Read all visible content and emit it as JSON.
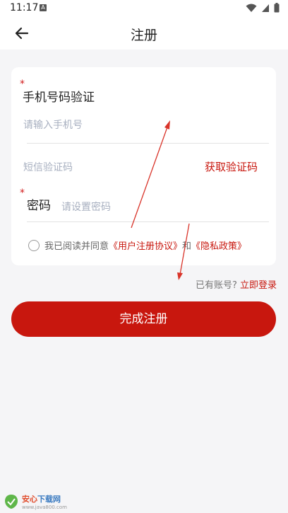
{
  "status": {
    "time": "11:17",
    "notification_badge": "A"
  },
  "appbar": {
    "title": "注册"
  },
  "form": {
    "phone_section_label": "手机号码验证",
    "required_mark": "*",
    "phone_placeholder": "请输入手机号",
    "code_placeholder": "短信验证码",
    "get_code_label": "获取验证码",
    "password_label": "密码",
    "password_placeholder": "请设置密码",
    "agree_prefix": "我已阅读并同意",
    "user_agreement": "《用户注册协议》",
    "agree_and": "和",
    "privacy_policy": "《隐私政策》"
  },
  "login": {
    "prompt": "已有账号?",
    "link": "立即登录"
  },
  "submit": {
    "label": "完成注册"
  },
  "watermark": {
    "brand_a": "安心",
    "brand_b": "下载网",
    "url": "www.java800.com"
  },
  "colors": {
    "accent": "#c8170e",
    "placeholder": "#a8b0c0",
    "annotation_arrow": "#d9342a"
  }
}
